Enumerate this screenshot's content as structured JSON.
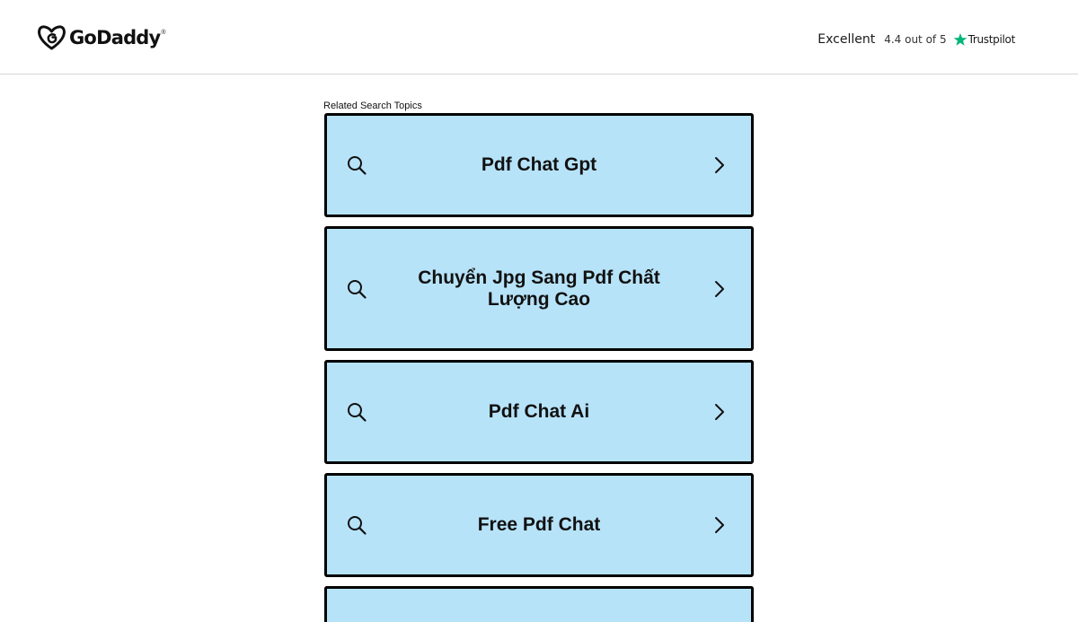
{
  "header": {
    "logo_text": "GoDaddy",
    "logo_tm": "®",
    "trustpilot": {
      "rating_word": "Excellent",
      "score_text": "4.4 out of 5",
      "brand": "Trustpilot",
      "star_color": "#00b67a"
    }
  },
  "related": {
    "heading": "Related Search Topics",
    "items": [
      {
        "label": "Pdf Chat Gpt"
      },
      {
        "label": "Chuyển Jpg Sang Pdf Chất Lượng Cao"
      },
      {
        "label": "Pdf Chat Ai"
      },
      {
        "label": "Free Pdf Chat"
      },
      {
        "label": ""
      }
    ]
  },
  "colors": {
    "topic_background": "#b7e3f9",
    "topic_border": "#000000",
    "header_divider": "#d6d6d6"
  },
  "icons": {
    "logo": "godaddy-logo-icon",
    "search": "search-icon",
    "chevron": "chevron-right-icon",
    "star": "trustpilot-star-icon"
  }
}
